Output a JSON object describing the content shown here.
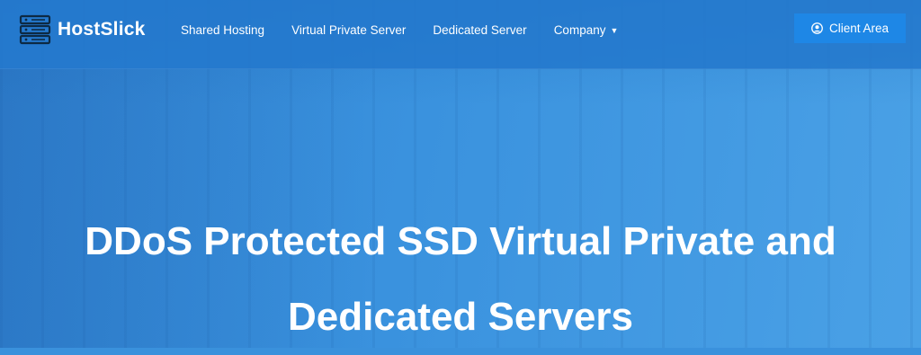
{
  "brand": {
    "name": "HostSlick",
    "logo_icon": "server-stack-icon"
  },
  "nav": {
    "items": [
      {
        "label": "Shared Hosting"
      },
      {
        "label": "Virtual Private Server"
      },
      {
        "label": "Dedicated Server"
      },
      {
        "label": "Company",
        "has_dropdown": true
      }
    ],
    "caret": "▼"
  },
  "client_area": {
    "label": "Client Area",
    "icon": "user-circle-icon"
  },
  "hero": {
    "line1": "DDoS Protected SSD Virtual Private and",
    "line2": "Dedicated Servers"
  },
  "colors": {
    "background": "#3a91dc",
    "navbar": "#2378cd",
    "button": "#1e87e6",
    "text": "#ffffff"
  }
}
